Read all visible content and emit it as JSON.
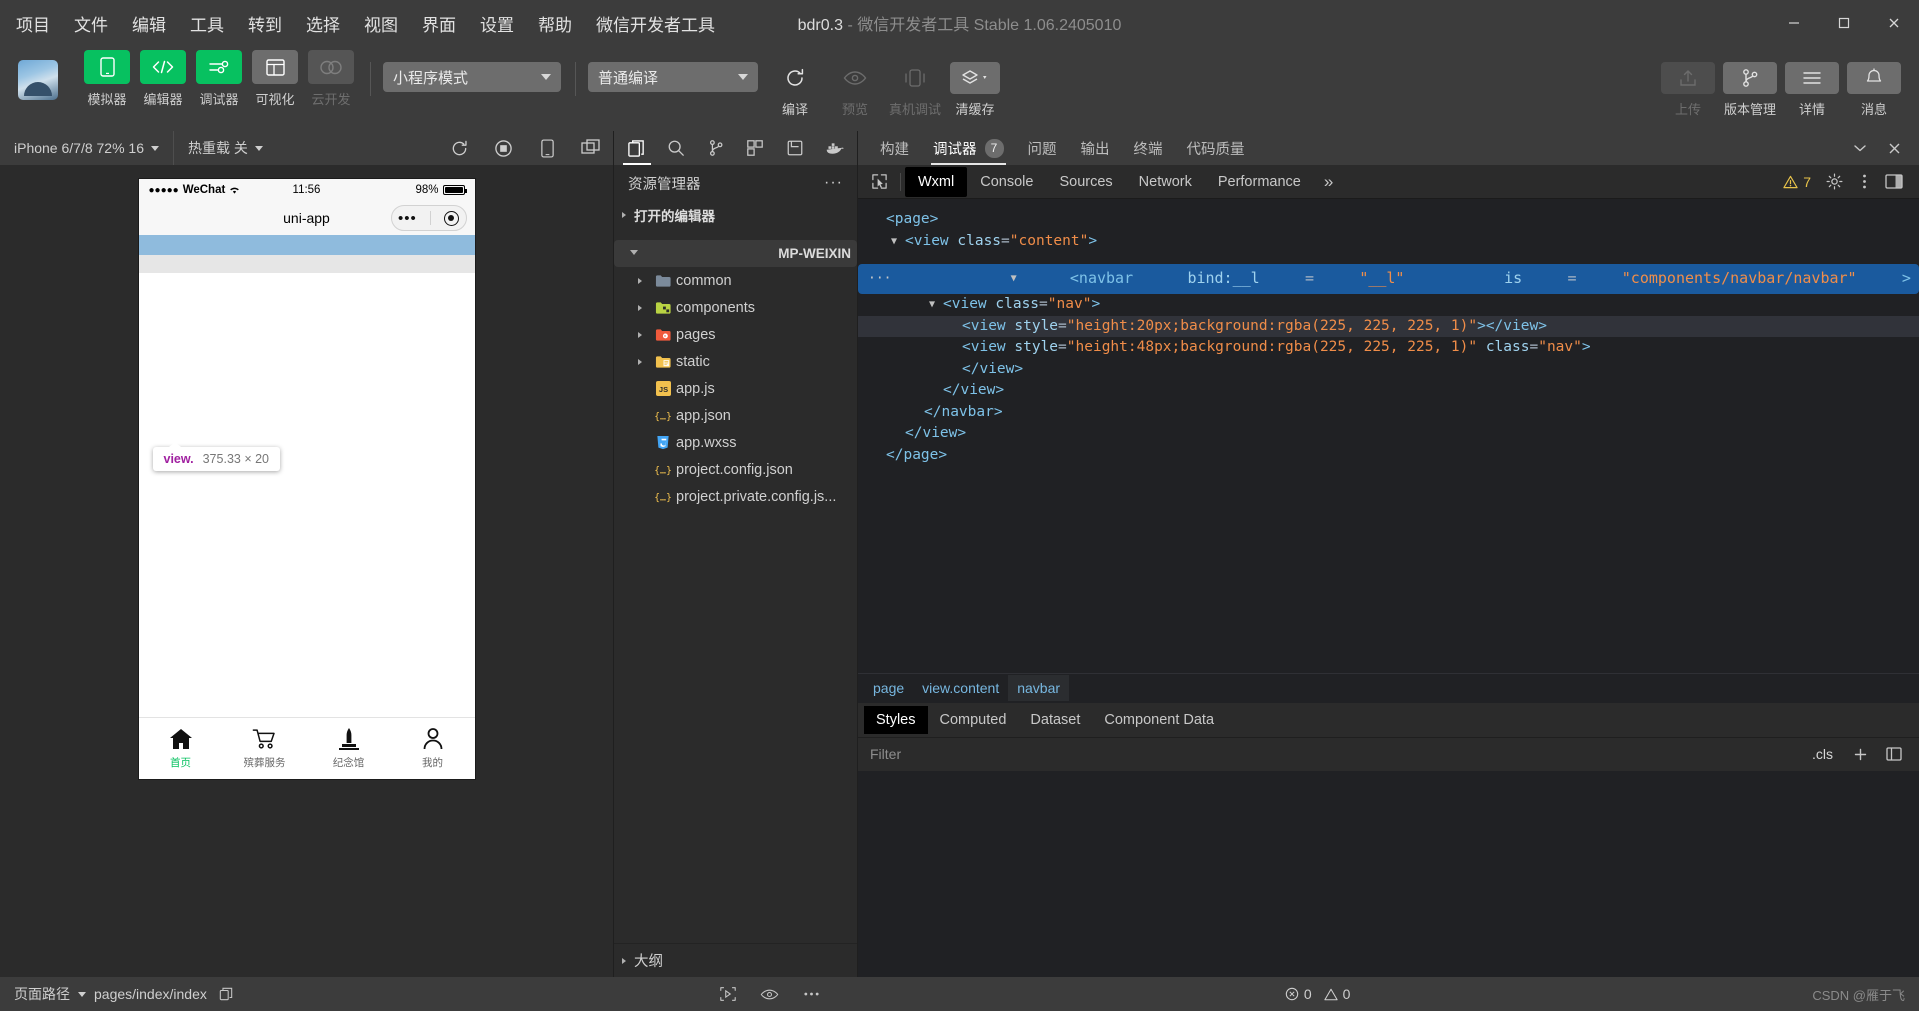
{
  "titlebar": {
    "menus": [
      "项目",
      "文件",
      "编辑",
      "工具",
      "转到",
      "选择",
      "视图",
      "界面",
      "设置",
      "帮助",
      "微信开发者工具"
    ],
    "project": "bdr0.3",
    "separator": "-",
    "app_name": "微信开发者工具 Stable 1.06.2405010",
    "window_controls": [
      "minimize-button",
      "maximize-button",
      "close-button"
    ]
  },
  "toolbar": {
    "mode_buttons": [
      {
        "label": "模拟器",
        "icon": "phone-icon",
        "state": "active"
      },
      {
        "label": "编辑器",
        "icon": "code-icon",
        "state": "active"
      },
      {
        "label": "调试器",
        "icon": "debug-icon",
        "state": "active"
      },
      {
        "label": "可视化",
        "icon": "layout-icon",
        "state": "inactive"
      },
      {
        "label": "云开发",
        "icon": "cloud-icon",
        "state": "disabled"
      }
    ],
    "mode_select": "小程序模式",
    "compile_select": "普通编译",
    "actions": [
      {
        "label": "编译",
        "icon": "refresh-icon",
        "state": "enabled"
      },
      {
        "label": "预览",
        "icon": "eye-icon",
        "state": "disabled"
      },
      {
        "label": "真机调试",
        "icon": "device-debug-icon",
        "state": "disabled"
      },
      {
        "label": "清缓存",
        "icon": "layers-icon",
        "state": "enabled"
      }
    ],
    "right_actions": [
      {
        "label": "上传",
        "icon": "upload-icon",
        "state": "disabled"
      },
      {
        "label": "版本管理",
        "icon": "git-branch-icon",
        "state": "enabled"
      },
      {
        "label": "详情",
        "icon": "menu-icon",
        "state": "enabled"
      },
      {
        "label": "消息",
        "icon": "bell-icon",
        "state": "enabled"
      }
    ]
  },
  "simulator": {
    "device_select": "iPhone 6/7/8 72% 16",
    "hotreload_select": "热重载 关",
    "toolbar_icons": [
      "refresh-icon",
      "stop-icon",
      "rotate-device-icon",
      "multi-window-icon"
    ],
    "phone": {
      "carrier": "WeChat",
      "signal_dots": "●●●●●",
      "time": "11:56",
      "battery": "98%",
      "nav_title": "uni-app",
      "capsule": {
        "more": "•••",
        "target": "target-icon"
      },
      "tooltip": {
        "tag": "view.",
        "size": "375.33 × 20"
      },
      "tabbar": [
        {
          "label": "首页",
          "icon": "home-icon",
          "active": true
        },
        {
          "label": "殡葬服务",
          "icon": "cart-icon",
          "active": false
        },
        {
          "label": "纪念馆",
          "icon": "monument-icon",
          "active": false
        },
        {
          "label": "我的",
          "icon": "person-icon",
          "active": false
        }
      ]
    },
    "footer": {
      "label": "页面路径",
      "path": "pages/index/index",
      "icons": [
        "copy-icon",
        "selector-icon",
        "eye-icon",
        "more-icon"
      ]
    }
  },
  "explorer": {
    "activity_icons": [
      "files-icon",
      "search-icon",
      "git-branch-icon",
      "extensions-icon",
      "save-icon",
      "docker-icon"
    ],
    "title": "资源管理器",
    "more": "···",
    "sections": [
      {
        "label": "打开的编辑器",
        "expanded": false
      },
      {
        "label": "MP-WEIXIN",
        "expanded": true
      }
    ],
    "files": [
      {
        "name": "common",
        "type": "folder",
        "icon": "folder-common-icon",
        "color": "#7b8a9a",
        "expandable": true
      },
      {
        "name": "components",
        "type": "folder",
        "icon": "folder-components-icon",
        "color": "#b9d343",
        "expandable": true
      },
      {
        "name": "pages",
        "type": "folder",
        "icon": "folder-pages-icon",
        "color": "#f05a3c",
        "expandable": true
      },
      {
        "name": "static",
        "type": "folder",
        "icon": "folder-static-icon",
        "color": "#f2c14e",
        "expandable": true
      },
      {
        "name": "app.js",
        "type": "file",
        "icon": "js-icon",
        "color": "#f2c14e",
        "expandable": false
      },
      {
        "name": "app.json",
        "type": "file",
        "icon": "json-icon",
        "color": "#f2c14e",
        "expandable": false
      },
      {
        "name": "app.wxss",
        "type": "file",
        "icon": "css-icon",
        "color": "#42a5f5",
        "expandable": false
      },
      {
        "name": "project.config.json",
        "type": "file",
        "icon": "json-icon",
        "color": "#f2c14e",
        "expandable": false
      },
      {
        "name": "project.private.config.js...",
        "type": "file",
        "icon": "json-icon",
        "color": "#f2c14e",
        "expandable": false
      }
    ],
    "outline": "大纲"
  },
  "devtools": {
    "top_tabs": [
      {
        "label": "构建",
        "active": false,
        "badge": null
      },
      {
        "label": "调试器",
        "active": true,
        "badge": "7"
      },
      {
        "label": "问题",
        "active": false,
        "badge": null
      },
      {
        "label": "输出",
        "active": false,
        "badge": null
      },
      {
        "label": "终端",
        "active": false,
        "badge": null
      },
      {
        "label": "代码质量",
        "active": false,
        "badge": null
      }
    ],
    "top_right_icons": [
      "chevron-down-icon",
      "close-icon"
    ],
    "panel_tabs": [
      {
        "label": "Wxml",
        "active": true
      },
      {
        "label": "Console",
        "active": false
      },
      {
        "label": "Sources",
        "active": false
      },
      {
        "label": "Network",
        "active": false
      },
      {
        "label": "Performance",
        "active": false
      }
    ],
    "panel_more": "»",
    "warning_count": "7",
    "panel_right_icons": [
      "warning-icon",
      "gear-icon",
      "kebab-icon",
      "dock-icon"
    ],
    "wxml_lines": [
      {
        "indent": 0,
        "twisty": "",
        "selected": false,
        "highlight": false,
        "parts": [
          {
            "t": "tag",
            "v": "<page>"
          }
        ]
      },
      {
        "indent": 1,
        "twisty": "▼",
        "selected": false,
        "highlight": false,
        "parts": [
          {
            "t": "tag",
            "v": "<view "
          },
          {
            "t": "attr",
            "v": "class"
          },
          {
            "t": "pnc",
            "v": "="
          },
          {
            "t": "val",
            "v": "\"content\""
          },
          {
            "t": "tag",
            "v": ">"
          }
        ]
      },
      {
        "indent": 2,
        "twisty": "▼",
        "selected": true,
        "highlight": false,
        "ellipsis": "···",
        "parts": [
          {
            "t": "tag",
            "v": "<navbar "
          },
          {
            "t": "attr",
            "v": "bind:__l"
          },
          {
            "t": "pnc",
            "v": "="
          },
          {
            "t": "val",
            "v": "\"__l\""
          },
          {
            "t": "pnc",
            "v": " "
          },
          {
            "t": "attr",
            "v": "is"
          },
          {
            "t": "pnc",
            "v": "="
          },
          {
            "t": "val",
            "v": "\"components/navbar/navbar\""
          },
          {
            "t": "tag",
            "v": ">"
          }
        ]
      },
      {
        "indent": 3,
        "twisty": "▼",
        "selected": false,
        "highlight": false,
        "parts": [
          {
            "t": "tag",
            "v": "<view "
          },
          {
            "t": "attr",
            "v": "class"
          },
          {
            "t": "pnc",
            "v": "="
          },
          {
            "t": "val",
            "v": "\"nav\""
          },
          {
            "t": "tag",
            "v": ">"
          }
        ]
      },
      {
        "indent": 4,
        "twisty": "",
        "selected": false,
        "highlight": true,
        "parts": [
          {
            "t": "tag",
            "v": "<view "
          },
          {
            "t": "attr",
            "v": "style"
          },
          {
            "t": "pnc",
            "v": "="
          },
          {
            "t": "val",
            "v": "\"height:20px;background:rgba(225, 225, 225, 1)\""
          },
          {
            "t": "tag",
            "v": "></view>"
          }
        ]
      },
      {
        "indent": 4,
        "twisty": "",
        "selected": false,
        "highlight": false,
        "parts": [
          {
            "t": "tag",
            "v": "<view "
          },
          {
            "t": "attr",
            "v": "style"
          },
          {
            "t": "pnc",
            "v": "="
          },
          {
            "t": "val",
            "v": "\"height:48px;background:rgba(225, 225, 225, 1)\""
          },
          {
            "t": "pnc",
            "v": " "
          },
          {
            "t": "attr",
            "v": "class"
          },
          {
            "t": "pnc",
            "v": "="
          },
          {
            "t": "val",
            "v": "\"nav\""
          },
          {
            "t": "tag",
            "v": ">"
          }
        ]
      },
      {
        "indent": 4,
        "twisty": "",
        "selected": false,
        "highlight": false,
        "parts": [
          {
            "t": "tag",
            "v": "</view>"
          }
        ]
      },
      {
        "indent": 3,
        "twisty": "",
        "selected": false,
        "highlight": false,
        "parts": [
          {
            "t": "tag",
            "v": "</view>"
          }
        ]
      },
      {
        "indent": 2,
        "twisty": "",
        "selected": false,
        "highlight": false,
        "parts": [
          {
            "t": "tag",
            "v": "</navbar>"
          }
        ]
      },
      {
        "indent": 1,
        "twisty": "",
        "selected": false,
        "highlight": false,
        "parts": [
          {
            "t": "tag",
            "v": "</view>"
          }
        ]
      },
      {
        "indent": 0,
        "twisty": "",
        "selected": false,
        "highlight": false,
        "parts": [
          {
            "t": "tag",
            "v": "</page>"
          }
        ]
      }
    ],
    "breadcrumbs": [
      {
        "label": "page",
        "active": false
      },
      {
        "label": "view.content",
        "active": false
      },
      {
        "label": "navbar",
        "active": true
      }
    ],
    "styles_tabs": [
      {
        "label": "Styles",
        "active": true
      },
      {
        "label": "Computed",
        "active": false
      },
      {
        "label": "Dataset",
        "active": false
      },
      {
        "label": "Component Data",
        "active": false
      }
    ],
    "filter_placeholder": "Filter",
    "filter_value": "",
    "cls_label": ".cls",
    "filter_icons": [
      "plus-icon",
      "panel-icon"
    ]
  },
  "statusbar": {
    "label": "页面路径",
    "path": "pages/index/index",
    "error_count": "0",
    "warning_count": "0",
    "watermark": "CSDN @雁于飞"
  },
  "colors": {
    "accent_green": "#07c160",
    "select_blue": "#1a5a9e",
    "tag_blue": "#7ec2e8",
    "value_orange": "#f08d49"
  }
}
